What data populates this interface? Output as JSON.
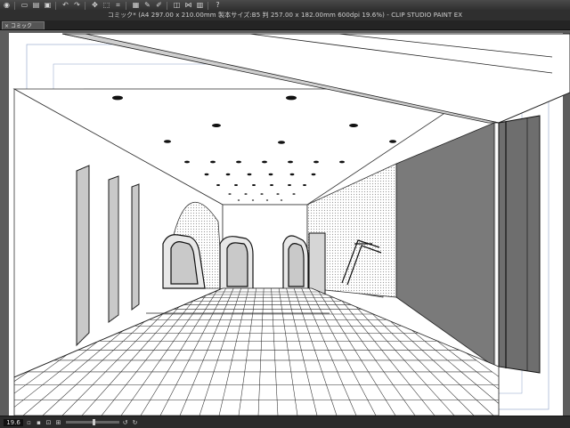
{
  "toolbar": {
    "items": [
      {
        "icon": "app-menu-icon",
        "glyph": "◉"
      },
      {
        "icon": "new-file-icon",
        "glyph": "▭"
      },
      {
        "icon": "open-file-icon",
        "glyph": "▤"
      },
      {
        "icon": "save-icon",
        "glyph": "▣"
      },
      {
        "icon": "undo-icon",
        "glyph": "↶"
      },
      {
        "icon": "redo-icon",
        "glyph": "↷"
      },
      {
        "icon": "transform-icon",
        "glyph": "✥"
      },
      {
        "icon": "deselect-icon",
        "glyph": "⬚"
      },
      {
        "icon": "crop-icon",
        "glyph": "⌗"
      },
      {
        "icon": "fill-icon",
        "glyph": "▦"
      },
      {
        "icon": "pen-icon",
        "glyph": "✎"
      },
      {
        "icon": "eraser-icon",
        "glyph": "✐"
      },
      {
        "icon": "ruler-icon",
        "glyph": "◫"
      },
      {
        "icon": "snap-icon",
        "glyph": "⋈"
      },
      {
        "icon": "grid-icon",
        "glyph": "▥"
      },
      {
        "icon": "help-icon",
        "glyph": "?"
      }
    ]
  },
  "titlebar": {
    "text": "コミック* (A4 297.00 x 210.00mm 製本サイズ:B5 判 257.00 x 182.00mm 600dpi 19.6%)  - CLIP STUDIO PAINT EX"
  },
  "tab": {
    "label": "コミック"
  },
  "status": {
    "zoom": "19.6"
  },
  "colors": {
    "app_bg": "#1e1e1e",
    "canvas_bg": "#5d5d5d",
    "paper": "#ffffff",
    "wall_dark": "#7a7a7a",
    "guide_blue": "#8aa0c8"
  }
}
